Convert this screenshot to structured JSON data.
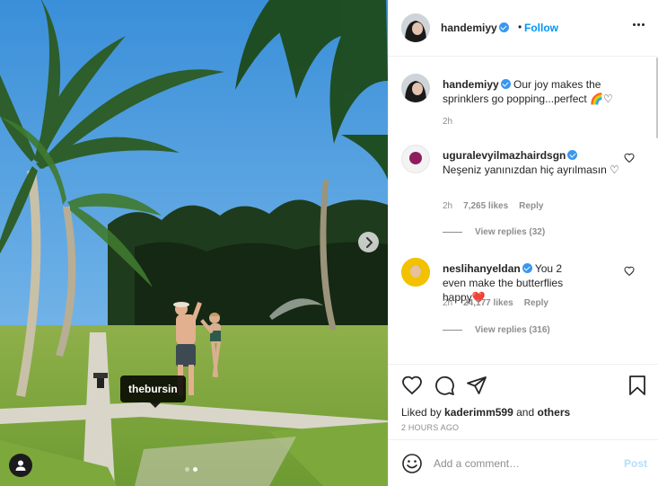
{
  "photo": {
    "tag_label": "thebursin",
    "carousel_total": 2,
    "carousel_active": 2
  },
  "header": {
    "username": "handemiyy",
    "separator": "•",
    "follow_label": "Follow"
  },
  "caption": {
    "username": "handemiyy",
    "text": "Our joy makes the sprinklers go popping...perfect 🌈♡",
    "time": "2h"
  },
  "comments": [
    {
      "username": "uguralevyilmazhairdsgn",
      "text": "Neşeniz yanınızdan hiç ayrılmasın ♡",
      "time": "2h",
      "likes": "7,265 likes",
      "reply_label": "Reply",
      "view_replies": "View replies (32)"
    },
    {
      "username": "neslihanyeldan",
      "text": "You 2 even make the butterflies happy❤️",
      "time": "2h",
      "likes": "24,177 likes",
      "reply_label": "Reply",
      "view_replies": "View replies (316)"
    }
  ],
  "likes": {
    "prefix": "Liked by",
    "user": "kaderimm599",
    "conjunction": "and",
    "others": "others"
  },
  "timestamp": "2 HOURS AGO",
  "composer": {
    "placeholder": "Add a comment…",
    "post_label": "Post"
  },
  "icons": {
    "like": "heart-icon",
    "comment": "comment-icon",
    "share": "paper-plane-icon",
    "save": "bookmark-icon",
    "emoji": "emoji-icon",
    "next": "chevron-right-icon",
    "tagged_users": "user-icon",
    "verified": "verified-badge-icon",
    "more": "more-options-icon"
  },
  "colors": {
    "accent": "#0095f6",
    "verified": "#3897f0",
    "post_disabled": "#b2dffc",
    "muted": "#8e8e8e",
    "heart_red": "#ed4956"
  }
}
